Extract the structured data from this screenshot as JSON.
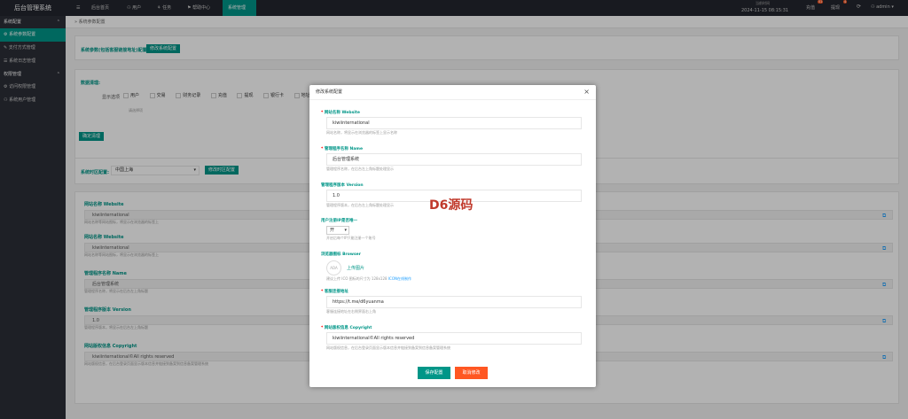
{
  "app": {
    "title": "后台管理系统"
  },
  "topnav": {
    "menu_icon": "☰",
    "items": [
      {
        "label": "后台首页",
        "icon": "home-icon"
      },
      {
        "label": "用户",
        "icon": "user-icon"
      },
      {
        "label": "任务",
        "icon": "tasks-icon"
      },
      {
        "label": "帮助中心",
        "icon": "flag-icon"
      },
      {
        "label": "系统管理",
        "icon": ""
      }
    ],
    "time_label": "当前时间",
    "time_value": "2024-11-15 08:15:31",
    "recharge": "充值",
    "recharge_badge": "51",
    "withdraw": "提现",
    "withdraw_badge": "4",
    "refresh_icon": "⟳",
    "user": "admin"
  },
  "sidebar": {
    "groups": [
      {
        "label": "系统配置",
        "items": [
          {
            "label": "系统参数配置",
            "active": true
          },
          {
            "label": "支付方式管理",
            "active": false
          },
          {
            "label": "系统日志管理",
            "active": false
          }
        ]
      },
      {
        "label": "权限管理",
        "items": [
          {
            "label": "访问权限管理",
            "active": false
          },
          {
            "label": "系统用户管理",
            "active": false
          }
        ]
      }
    ]
  },
  "breadcrumb": "系统参数配置",
  "section1": {
    "label": "系统参数(包括客服链接地址)配置:",
    "button": "修改系统配置"
  },
  "section2": {
    "title": "数据清理:",
    "options_label": "显示选项",
    "options": [
      "用户",
      "交易",
      "财务记录",
      "充值",
      "提现",
      "银行卡",
      "地址"
    ],
    "hint": "请选择项",
    "button": "确定清理"
  },
  "section3": {
    "label": "系统时区配置:",
    "select_value": "中国上海",
    "button": "修改时区配置"
  },
  "bglist": [
    {
      "label": "网站名称 Website",
      "value": "kiwiinternational",
      "hint": "网站名称等网站图标，将显示在浏览器的标签上"
    },
    {
      "label": "网站名称 Website",
      "value": "kiwiinternational",
      "hint": "网站名称等网站图标，将显示在浏览器的标签上"
    },
    {
      "label": "管理程序名称 Name",
      "value": "后台管理系统",
      "hint": "管理程序名称，将显示在后台左上角标题"
    },
    {
      "label": "管理程序版本 Version",
      "value": "1.0",
      "hint": "管理程序版本，将显示在后台左上角标题"
    },
    {
      "label": "网站版权信息 Copyright",
      "value": "kiwiinternational©All rights reserved",
      "hint": "网站版权信息，在后台登录页面显示版本信息并链接到备案到信息备案管理系统"
    }
  ],
  "modal": {
    "title": "修改系统配置",
    "close": "×",
    "fields": [
      {
        "label": "网站名称 Website",
        "value": "kiwiinternational",
        "hint": "网站名称，将显示在浏览器的标签上显示名称",
        "required": true
      },
      {
        "label": "管理程序名称 Name",
        "value": "后台管理系统",
        "hint": "管理程序名称，在后台左上角标题处理显示",
        "required": true
      },
      {
        "label": "管理程序版本 Version",
        "value": "1.0",
        "hint": "管理程序版本，在后台左上角标题处理显示",
        "required": false
      },
      {
        "label": "用户注册IP是否唯一",
        "value": "开",
        "hint": "开启后每个IP只能注册一个账号",
        "required": false
      },
      {
        "label": "浏览器图标 Browser",
        "value": "",
        "hint": "建议上传 ICO 图标的尺寸为 128x128",
        "hint_link": "ICON在线制作",
        "upload": "上传图片",
        "logo_text": "ADA",
        "required": false
      },
      {
        "label": "客服连接地址",
        "value": "https://t.me/d6yuanma",
        "hint": "客服连接地址在右侧界面右上角",
        "required": true
      },
      {
        "label": "网站版权信息 Copyright",
        "value": "kiwiinternational©All rights reserved",
        "hint": "网站版权信息，在后台登录页面显示版本信息并链接到备案到信息备案管理系统",
        "required": true
      }
    ],
    "save": "保存配置",
    "cancel": "取消修改"
  },
  "watermark": "D6源码",
  "colors": {
    "accent": "#009688",
    "danger": "#ff5722",
    "topbar": "#23262e",
    "sidebar": "#2b2e37"
  }
}
